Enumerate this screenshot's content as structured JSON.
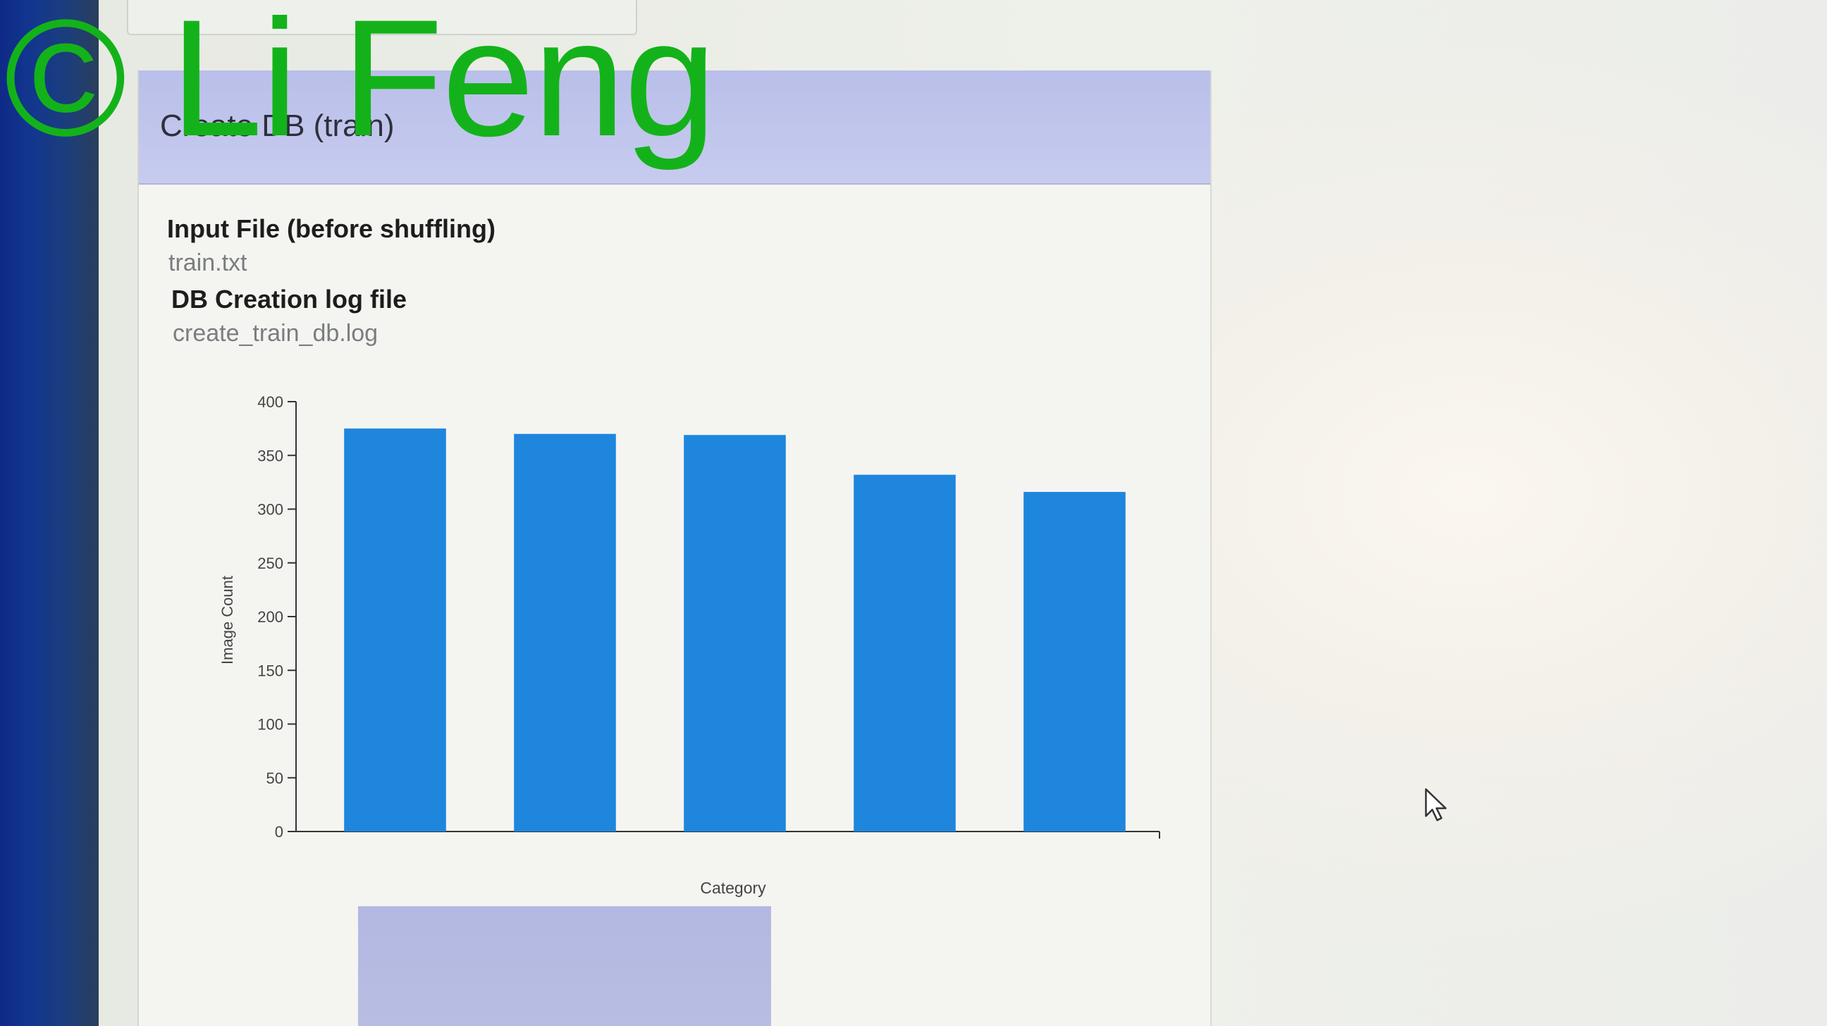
{
  "panel": {
    "title": "Create DB (train)",
    "fields": [
      {
        "label": "Input File (before shuffling)",
        "value": "train.txt"
      },
      {
        "label": "DB Creation log file",
        "value": "create_train_db.log"
      }
    ]
  },
  "watermark": "© Li Feng",
  "colors": {
    "bar": "#1f86dd",
    "heading": "#bcc1ea",
    "watermark": "#14b21a"
  },
  "chart_data": {
    "type": "bar",
    "categories": [
      "",
      "",
      "",
      "",
      ""
    ],
    "values": [
      375,
      370,
      369,
      332,
      316
    ],
    "xlabel": "Category",
    "ylabel": "Image Count",
    "ylim": [
      0,
      400
    ],
    "yticks": [
      0,
      50,
      100,
      150,
      200,
      250,
      300,
      350,
      400
    ],
    "grid": false
  }
}
